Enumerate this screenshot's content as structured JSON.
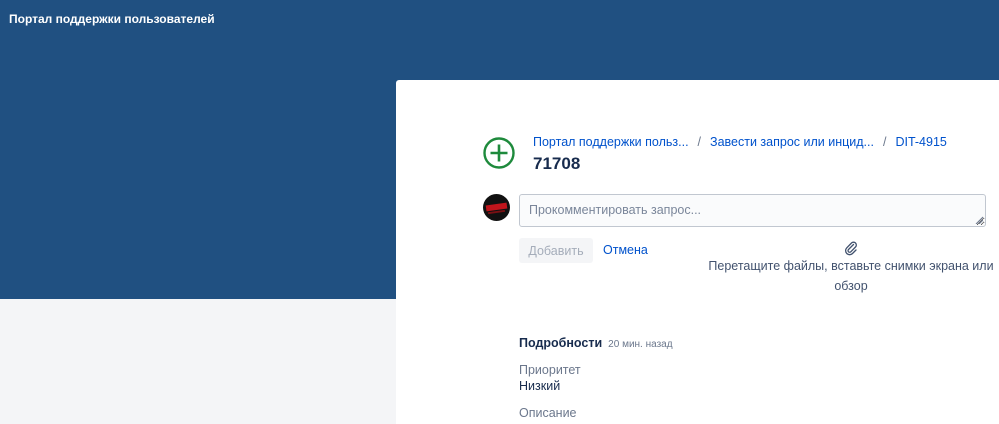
{
  "header": {
    "portal_title": "Портал поддержки пользователей"
  },
  "breadcrumb": {
    "items": [
      "Портал поддержки польз...",
      "Завести запрос или инцид...",
      "DIT-4915"
    ],
    "separator": "/"
  },
  "issue": {
    "title": "71708",
    "type_icon": "plus-circle-icon",
    "type_icon_color": "#1e8a3c"
  },
  "comment": {
    "placeholder": "Прокомментировать запрос...",
    "add_label": "Добавить",
    "cancel_label": "Отмена"
  },
  "attachments": {
    "icon": "paperclip-icon",
    "line1": "Перетащите файлы, вставьте снимки экрана или",
    "line2": "обзор"
  },
  "details": {
    "title": "Подробности",
    "time": "20 мин. назад",
    "fields": [
      {
        "label": "Приоритет",
        "value": "Низкий"
      },
      {
        "label": "Описание",
        "value": ""
      }
    ]
  },
  "colors": {
    "header_bg": "#205081",
    "page_bg": "#f4f5f7",
    "link": "#0052cc"
  }
}
